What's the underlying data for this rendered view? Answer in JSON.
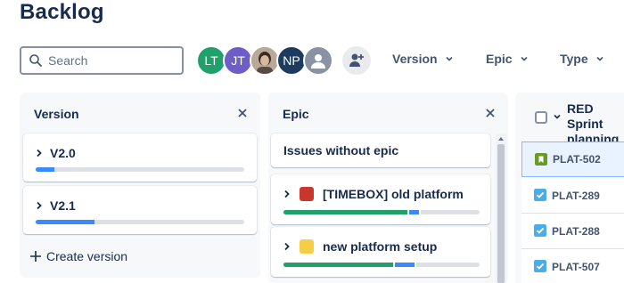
{
  "page": {
    "title": "Backlog"
  },
  "search": {
    "placeholder": "Search",
    "value": ""
  },
  "avatars": [
    {
      "initials": "LT",
      "color": "#22a06b"
    },
    {
      "initials": "JT",
      "color": "#6e5dc6"
    },
    {
      "initials": "",
      "type": "photo"
    },
    {
      "initials": "NP",
      "color": "#1d3b5e"
    },
    {
      "initials": "",
      "type": "unassigned"
    }
  ],
  "filters": {
    "version": "Version",
    "epic": "Epic",
    "type": "Type"
  },
  "version_panel": {
    "title": "Version",
    "versions": [
      {
        "name": "V2.0",
        "progress_blue": 0.09
      },
      {
        "name": "V2.1",
        "progress_blue": 0.28
      }
    ],
    "create_label": "Create version"
  },
  "epic_panel": {
    "title": "Epic",
    "no_epic_label": "Issues without epic",
    "epics": [
      {
        "name": "[TIMEBOX] old platform",
        "color": "#c9372c",
        "progress_green": 0.63,
        "progress_blue": 0.05
      },
      {
        "name": "new platform setup",
        "color": "#f5cd47",
        "progress_green": 0.56,
        "progress_blue": 0.1
      }
    ]
  },
  "sprint": {
    "title": "RED Sprint planning",
    "issues": [
      {
        "key": "PLAT-502",
        "type": "story",
        "color": "#6a9a23"
      },
      {
        "key": "PLAT-289",
        "type": "task",
        "color": "#4bade8"
      },
      {
        "key": "PLAT-288",
        "type": "task",
        "color": "#4bade8"
      },
      {
        "key": "PLAT-507",
        "type": "task",
        "color": "#4bade8"
      }
    ]
  },
  "colors": {
    "accent": "#388bff",
    "done": "#22a06b",
    "text": "#172b4d"
  }
}
